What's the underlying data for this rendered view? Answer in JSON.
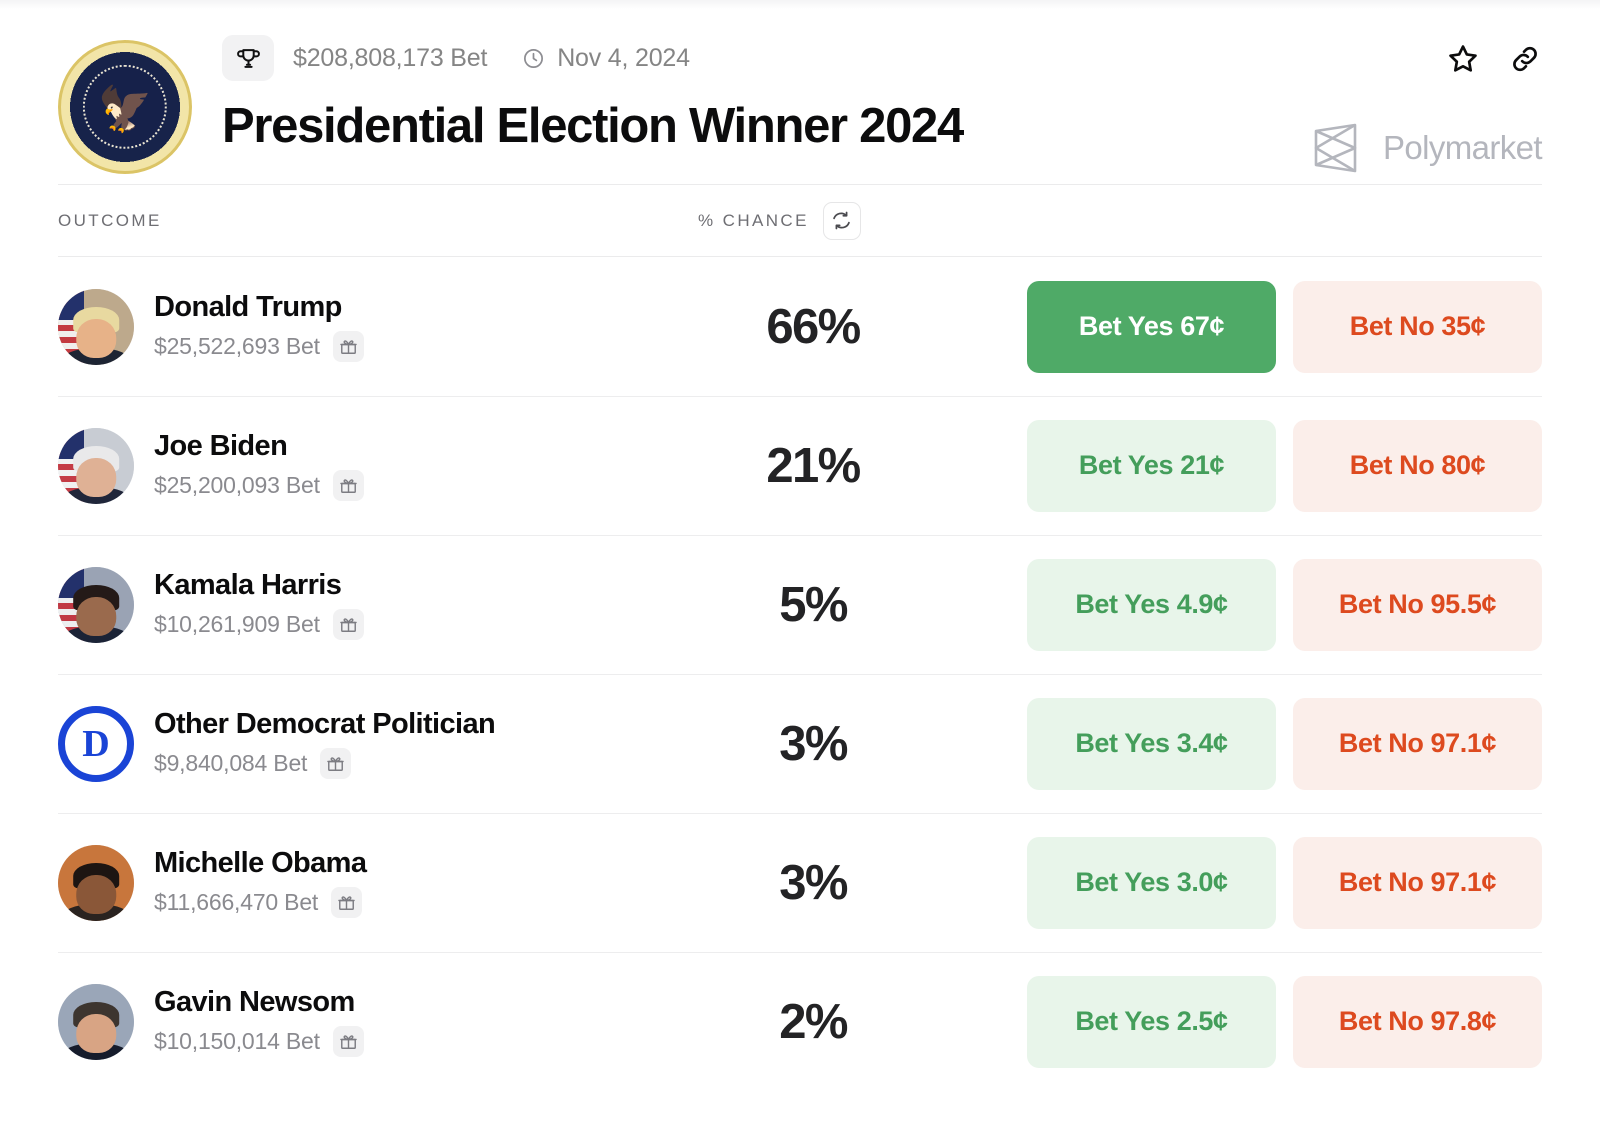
{
  "header": {
    "seal_alt": "presidential-seal",
    "volume": "$208,808,173 Bet",
    "date": "Nov 4, 2024",
    "title": "Presidential Election Winner 2024",
    "brand": "Polymarket",
    "icons": {
      "trophy": "trophy-icon",
      "clock": "clock-icon",
      "star": "star-icon",
      "link": "link-icon"
    }
  },
  "table": {
    "col_outcome": "OUTCOME",
    "col_chance": "% CHANCE",
    "refresh": "refresh-icon",
    "rows": [
      {
        "name": "Donald Trump",
        "bet": "$25,522,693 Bet",
        "chance": "66%",
        "yes": "Bet Yes 67¢",
        "no": "Bet No 35¢",
        "yes_active": true,
        "avatar": "photo-trump"
      },
      {
        "name": "Joe Biden",
        "bet": "$25,200,093 Bet",
        "chance": "21%",
        "yes": "Bet Yes 21¢",
        "no": "Bet No 80¢",
        "yes_active": false,
        "avatar": "photo-biden"
      },
      {
        "name": "Kamala Harris",
        "bet": "$10,261,909 Bet",
        "chance": "5%",
        "yes": "Bet Yes 4.9¢",
        "no": "Bet No 95.5¢",
        "yes_active": false,
        "avatar": "photo-harris"
      },
      {
        "name": "Other Democrat Politician",
        "bet": "$9,840,084 Bet",
        "chance": "3%",
        "yes": "Bet Yes 3.4¢",
        "no": "Bet No 97.1¢",
        "yes_active": false,
        "avatar": "democrat-logo",
        "logo_letter": "D"
      },
      {
        "name": "Michelle Obama",
        "bet": "$11,666,470 Bet",
        "chance": "3%",
        "yes": "Bet Yes 3.0¢",
        "no": "Bet No 97.1¢",
        "yes_active": false,
        "avatar": "photo-obama"
      },
      {
        "name": "Gavin Newsom",
        "bet": "$10,150,014 Bet",
        "chance": "2%",
        "yes": "Bet Yes 2.5¢",
        "no": "Bet No 97.8¢",
        "yes_active": false,
        "avatar": "photo-newsom"
      }
    ]
  },
  "colors": {
    "green_solid": "#4faa67",
    "green_soft_bg": "#e8f5ea",
    "green_text": "#449e5b",
    "red_soft_bg": "#fbeeea",
    "red_text": "#dd4a1f",
    "dem_blue": "#1a44d6",
    "muted_text": "#8a8a8f"
  }
}
